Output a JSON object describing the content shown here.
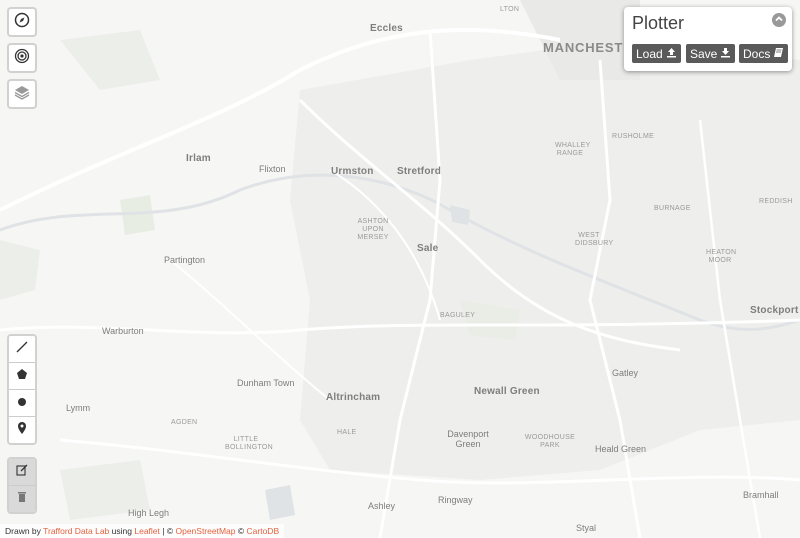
{
  "map": {
    "places": [
      {
        "id": "eccles",
        "text": "Eccles",
        "style": "big"
      },
      {
        "id": "lton",
        "text": "LTON",
        "style": "small"
      },
      {
        "id": "manchester",
        "text": "MANCHESTER",
        "style": "city"
      },
      {
        "id": "irlam",
        "text": "Irlam",
        "style": "big"
      },
      {
        "id": "flixton",
        "text": "Flixton",
        "style": "med"
      },
      {
        "id": "urmston",
        "text": "Urmston",
        "style": "big"
      },
      {
        "id": "stretford",
        "text": "Stretford",
        "style": "big"
      },
      {
        "id": "whalley-range",
        "text": "WHALLEY RANGE",
        "style": "small"
      },
      {
        "id": "rusholme",
        "text": "RUSHOLME",
        "style": "small"
      },
      {
        "id": "burnage",
        "text": "BURNAGE",
        "style": "small"
      },
      {
        "id": "reddish",
        "text": "REDDISH",
        "style": "small"
      },
      {
        "id": "ashton-upon-mersey",
        "text": "ASHTON UPON MERSEY",
        "style": "small"
      },
      {
        "id": "sale",
        "text": "Sale",
        "style": "big"
      },
      {
        "id": "west-didsbury",
        "text": "WEST DIDSBURY",
        "style": "small"
      },
      {
        "id": "heaton-moor",
        "text": "HEATON MOOR",
        "style": "small"
      },
      {
        "id": "partington",
        "text": "Partington",
        "style": "med"
      },
      {
        "id": "baguley",
        "text": "BAGULEY",
        "style": "small"
      },
      {
        "id": "stockport",
        "text": "Stockport",
        "style": "big"
      },
      {
        "id": "warburton",
        "text": "Warburton",
        "style": "med"
      },
      {
        "id": "gatley",
        "text": "Gatley",
        "style": "med"
      },
      {
        "id": "dunham-town",
        "text": "Dunham Town",
        "style": "med"
      },
      {
        "id": "newall-green",
        "text": "Newall Green",
        "style": "big"
      },
      {
        "id": "altrincham",
        "text": "Altrincham",
        "style": "big"
      },
      {
        "id": "lymm",
        "text": "Lymm",
        "style": "med"
      },
      {
        "id": "agden",
        "text": "AGDEN",
        "style": "small"
      },
      {
        "id": "hale",
        "text": "HALE",
        "style": "small"
      },
      {
        "id": "davenport-green",
        "text": "Davenport Green",
        "style": "med"
      },
      {
        "id": "woodhouse-park",
        "text": "WOODHOUSE PARK",
        "style": "small"
      },
      {
        "id": "little-bollington",
        "text": "LITTLE BOLLINGTON",
        "style": "small"
      },
      {
        "id": "heald-green",
        "text": "Heald Green",
        "style": "med"
      },
      {
        "id": "high-legh",
        "text": "High Legh",
        "style": "med"
      },
      {
        "id": "ringway",
        "text": "Ringway",
        "style": "med"
      },
      {
        "id": "ashley",
        "text": "Ashley",
        "style": "med"
      },
      {
        "id": "bramhall",
        "text": "Bramhall",
        "style": "med"
      },
      {
        "id": "styal",
        "text": "Styal",
        "style": "med"
      }
    ]
  },
  "controls": {
    "top": [
      {
        "id": "compass",
        "icon": "compass-icon"
      },
      {
        "id": "locate",
        "icon": "target-icon"
      },
      {
        "id": "layers",
        "icon": "layers-icon"
      }
    ],
    "draw": [
      {
        "id": "draw-line",
        "icon": "polyline-icon"
      },
      {
        "id": "draw-polygon",
        "icon": "polygon-icon"
      },
      {
        "id": "draw-circle",
        "icon": "circle-icon"
      },
      {
        "id": "draw-marker",
        "icon": "marker-icon"
      }
    ],
    "edit": [
      {
        "id": "edit-layers",
        "icon": "edit-icon"
      },
      {
        "id": "delete-layers",
        "icon": "trash-icon"
      }
    ]
  },
  "plotter": {
    "title": "Plotter",
    "collapse_icon": "chevron-up-icon",
    "load_label": "Load",
    "save_label": "Save",
    "docs_label": "Docs"
  },
  "attribution": {
    "prefix": "Drawn by",
    "lab": "Trafford Data Lab",
    "using": "using",
    "leaflet": "Leaflet",
    "sep": "| ©",
    "osm": "OpenStreetMap",
    "copy": "©",
    "carto": "CartoDB"
  },
  "colors": {
    "map_bg": "#f6f6f4",
    "road": "#ffffff",
    "green": "#e8ede4",
    "water": "#dfe3e6",
    "link": "#e3623e",
    "button": "#5a5a5a"
  }
}
